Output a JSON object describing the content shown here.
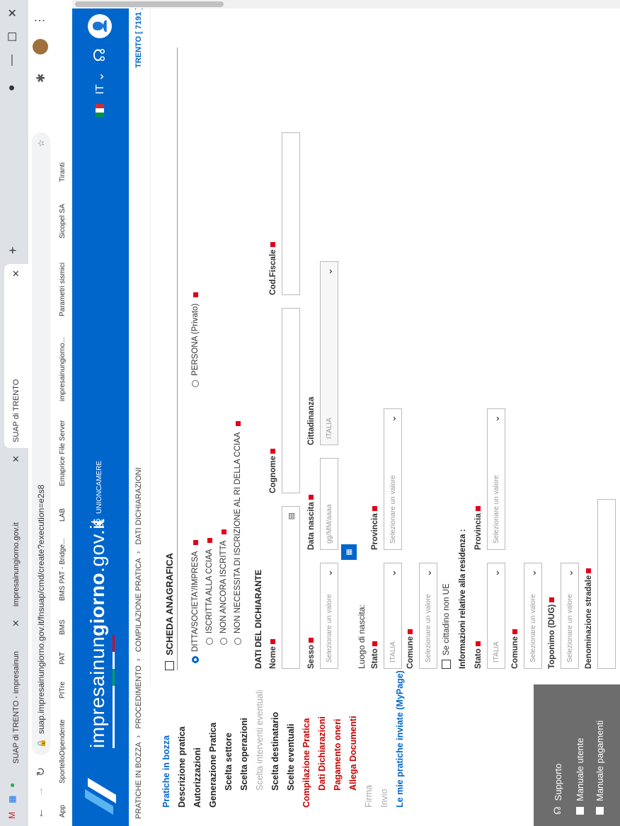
{
  "browser": {
    "tabs": [
      {
        "label": "SUAP di TRENTO - impresainun",
        "active": false
      },
      {
        "label": "impresainungiorno.gov.it",
        "active": false
      },
      {
        "label": "SUAP di TRENTO",
        "active": true
      }
    ],
    "new_tab": "+",
    "url": "suap.impresainungiorno.gov.it/fnsuap/cmd/create?execution=e2s8",
    "bookmarks": [
      "App",
      "SportelloDipendente",
      "PITre",
      "PAT",
      "BMS",
      "BMS PAT - Bridge...",
      "LAB",
      "Emaprice File Server",
      "impresainungiorno...",
      "Parametri sismici",
      "Sicopel SA",
      "Tiranti"
    ]
  },
  "header": {
    "brand_light": "impresainun",
    "brand_bold": "giorno",
    "brand_suffix": ".gov.it",
    "unioncamere": "UNIONCAMERE",
    "lang": "IT",
    "location": "TRENTO [ 7191 ]"
  },
  "breadcrumb": [
    "PRATICHE IN BOZZA",
    "PROCEDIMENTO",
    "COMPILAZIONE PRATICA",
    "DATI DICHIARAZIONI"
  ],
  "sidebar": {
    "pratiche_in_bozza": "Pratiche in bozza",
    "descrizione_pratica": "Descrizione pratica",
    "autorizzazioni": "Autorizzazioni",
    "generazione_pratica": "Generazione Pratica",
    "scelta_settore": "Scelta settore",
    "scelta_operazioni": "Scelta operazioni",
    "scelta_interventi": "Scelta interventi eventuali",
    "scelta_destinatario": "Scelta destinatario",
    "scelte_eventuali": "Scelte eventuali",
    "compilazione_pratica": "Compilazione Pratica",
    "dati_dichiarazioni": "Dati Dichiarazioni",
    "pagamento_oneri": "Pagamento oneri",
    "allega_documenti": "Allega Documenti",
    "firma": "Firma",
    "invio": "Invio",
    "mie_pratiche": "Le mie pratiche inviate (MyPage)",
    "supporto": "Supporto",
    "manuale_utente": "Manuale utente",
    "manuale_pagamenti": "Manuale pagamenti"
  },
  "form": {
    "section_title": "SCHEDA ANAGRAFICA",
    "radio_ditta": "DITTA/SOCIETA'/IMPRESA",
    "radio_persona": "PERSONA (Privato)",
    "radio_iscritta": "ISCRITTA ALLA CCIAA",
    "radio_non_ancora": "NON ANCORA ISCRITTA",
    "radio_non_necessita": "NON NECESSITA DI ISCRIZIONE AL RI DELLA CCIAA",
    "dati_dichiarante": "DATI DEL DICHIARANTE",
    "nome": "Nome",
    "cognome": "Cognome",
    "cod_fiscale": "Cod.Fiscale",
    "sesso": "Sesso",
    "sesso_value": "Selezionare un valore",
    "data_nascita": "Data nascita",
    "data_placeholder": "gg/MM/aaaa",
    "cittadinanza": "Cittadinanza",
    "cittadinanza_value": "ITALIA",
    "luogo_nascita": "Luogo di nascita:",
    "stato": "Stato",
    "stato_value": "ITALIA",
    "provincia": "Provincia",
    "provincia_value": "Selezionare un valore",
    "comune": "Comune",
    "comune_value": "Selezionare un valore",
    "cittadino_non_ue": "Se cittadino non UE",
    "info_residenza": "Informazioni relative alla residenza :",
    "res_stato": "Stato",
    "res_stato_value": "ITALIA",
    "res_provincia": "Provincia",
    "res_provincia_value": "Selezionare un valore",
    "res_comune": "Comune",
    "res_comune_value": "Selezionare un valore",
    "toponimo": "Toponimo (DUG)",
    "toponimo_value": "Selezionare un valore",
    "denominazione": "Denominazione stradale"
  },
  "colors": {
    "brand_blue": "#0066cc",
    "required_red": "#e2001a",
    "active_red": "#cc0000"
  }
}
